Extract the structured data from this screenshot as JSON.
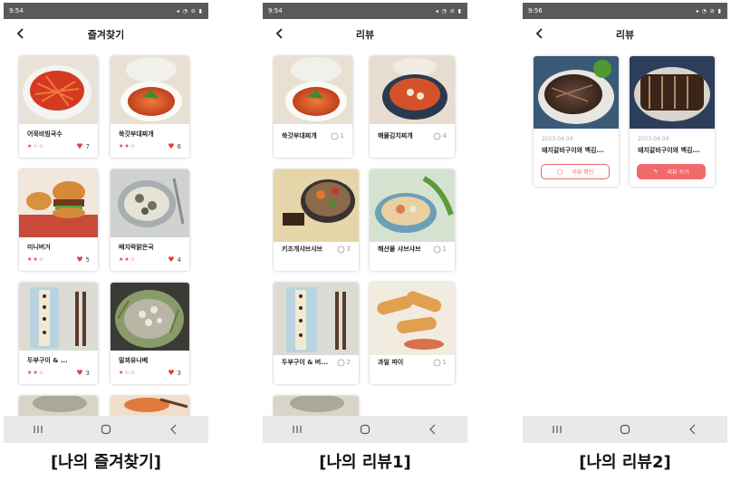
{
  "colors": {
    "accent": "#e63c3c",
    "button": "#f06a6a",
    "statusbar": "#5a5a5a",
    "navbar": "#e9e9e9"
  },
  "screens": [
    {
      "time": "9:54",
      "title": "즐겨찾기",
      "caption": "[나의 즐겨찾기]",
      "items": [
        {
          "name": "어묵비빔국수",
          "stars": "★☆☆",
          "count": "7"
        },
        {
          "name": "쑥갓부대찌개",
          "stars": "★★☆",
          "count": "6"
        },
        {
          "name": "미니버거",
          "stars": "★★☆",
          "count": "5"
        },
        {
          "name": "배지락맑은국",
          "stars": "★★☆",
          "count": "4"
        },
        {
          "name": "두부구이 & ...",
          "stars": "★★☆",
          "count": "3"
        },
        {
          "name": "밀꾀유나베",
          "stars": "★☆☆",
          "count": "3"
        }
      ]
    },
    {
      "time": "9:54",
      "title": "리뷰",
      "caption": "[나의 리뷰1]",
      "items": [
        {
          "name": "쑥갓부대찌개",
          "count": "1"
        },
        {
          "name": "해물김치찌개",
          "count": "4"
        },
        {
          "name": "키조개샤브샤브",
          "count": "3"
        },
        {
          "name": "해산물 샤브샤브",
          "count": "1"
        },
        {
          "name": "두부구이 & 버...",
          "count": "2"
        },
        {
          "name": "과일 파이",
          "count": "1"
        }
      ]
    },
    {
      "time": "9:56",
      "title": "리뷰",
      "caption": "[나의 리뷰2]",
      "items": [
        {
          "date": "2023.04.04",
          "name": "돼지갈비구이와 백김...",
          "button": "리뷰 확인"
        },
        {
          "date": "2023.04.04",
          "name": "돼지갈비구이와 백김...",
          "button": "리뷰 쓰기"
        }
      ]
    }
  ],
  "icons": {
    "back": "chevron-left-icon",
    "recent": "recent-apps-icon",
    "home": "home-icon",
    "navback": "nav-back-icon",
    "heart": "heart-icon",
    "comment": "comment-icon"
  }
}
